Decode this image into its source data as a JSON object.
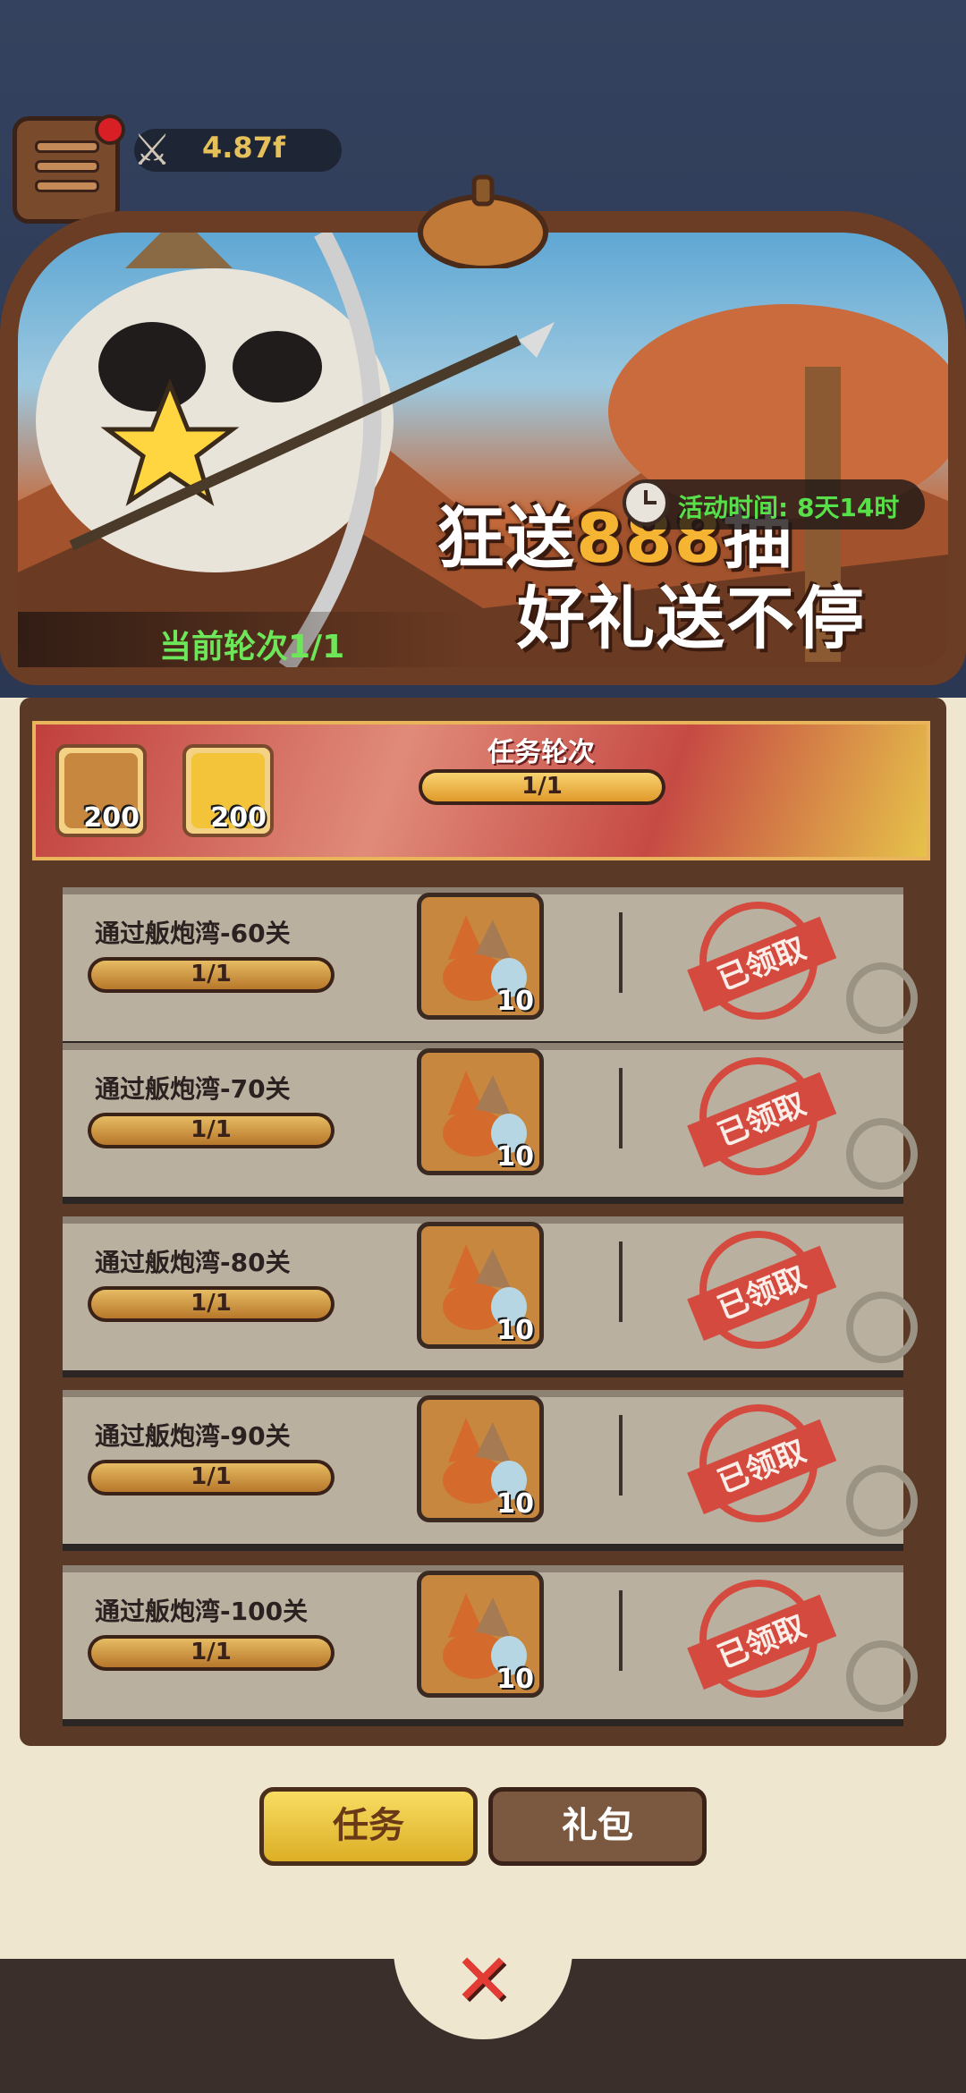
{
  "hud": {
    "power_value": "4.87f",
    "icons": [
      "menu-icon",
      "crossed-swords-icon",
      "bee-icon",
      "card-icon"
    ]
  },
  "banner": {
    "slogan_line1_prefix": "狂送",
    "slogan_line1_number": "888",
    "slogan_line1_suffix": "抽",
    "slogan_line2": "好礼送不停",
    "activity_time": "活动时间: 8天14时",
    "current_round": "当前轮次1/1"
  },
  "task_header": {
    "title": "任务轮次",
    "progress_text": "1/1",
    "progress": 1.0,
    "rewards": [
      {
        "icon": "fox-token-icon",
        "count": "200"
      },
      {
        "icon": "gold-orb-icon",
        "count": "200"
      }
    ]
  },
  "tasks": [
    {
      "title": "通过舨炮湾-60关",
      "progress_text": "1/1",
      "progress": 1.0,
      "reward_count": "10",
      "status": "已领取"
    },
    {
      "title": "通过舨炮湾-70关",
      "progress_text": "1/1",
      "progress": 1.0,
      "reward_count": "10",
      "status": "已领取"
    },
    {
      "title": "通过舨炮湾-80关",
      "progress_text": "1/1",
      "progress": 1.0,
      "reward_count": "10",
      "status": "已领取"
    },
    {
      "title": "通过舨炮湾-90关",
      "progress_text": "1/1",
      "progress": 1.0,
      "reward_count": "10",
      "status": "已领取"
    },
    {
      "title": "通过舨炮湾-100关",
      "progress_text": "1/1",
      "progress": 1.0,
      "reward_count": "10",
      "status": "已领取"
    }
  ],
  "tabs": {
    "task_label": "任务",
    "gift_label": "礼包",
    "active": "task"
  },
  "colors": {
    "accent_gold": "#f5b532",
    "timer_green": "#58e04a",
    "stamp_red": "#d54a3e",
    "panel_brown": "#5a3a26"
  }
}
